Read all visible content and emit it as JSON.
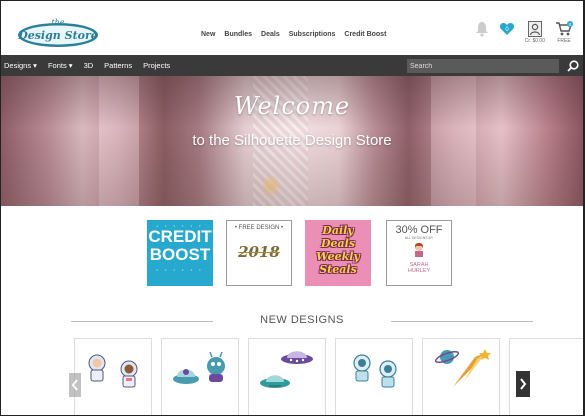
{
  "header": {
    "logo_alt": "The Design Store",
    "logo_line1": "the",
    "logo_line2": "Design Store",
    "nav": [
      "New",
      "Bundles",
      "Deals",
      "Subscriptions",
      "Credit Boost"
    ],
    "account_credit": "Cr. $0.00",
    "cart_label": "FREE",
    "heart_count": "0",
    "cart_count": "0"
  },
  "subnav": {
    "items": [
      "Designs ▾",
      "Fonts ▾",
      "3D",
      "Patterns",
      "Projects"
    ],
    "search_placeholder": "Search"
  },
  "hero": {
    "title": "Welcome",
    "subtitle": "to the Silhouette Design Store"
  },
  "promos": {
    "credit_line1": "CREDIT",
    "credit_line2": "BOOST",
    "free_label": "• FREE DESIGN •",
    "free_year": "2018",
    "daily_line1": "Daily",
    "daily_line2": "Deals",
    "daily_line3": "Weekly",
    "daily_line4": "Steals",
    "sale_pct": "30% OFF",
    "sale_all": "ALL DESIGNS BY",
    "sale_name1": "SARAH",
    "sale_name2": "HURLEY"
  },
  "new_designs": {
    "title": "NEW DESIGNS",
    "cards": [
      "astronauts",
      "aliens-ufo",
      "ufo-saucers",
      "robots",
      "planet-comet",
      "partial"
    ]
  },
  "colors": {
    "accent_blue": "#27a8cf",
    "nav_dark": "#3a3a3a",
    "logo_teal": "#2a7f9a",
    "promo_pink": "#ec8fb7"
  }
}
